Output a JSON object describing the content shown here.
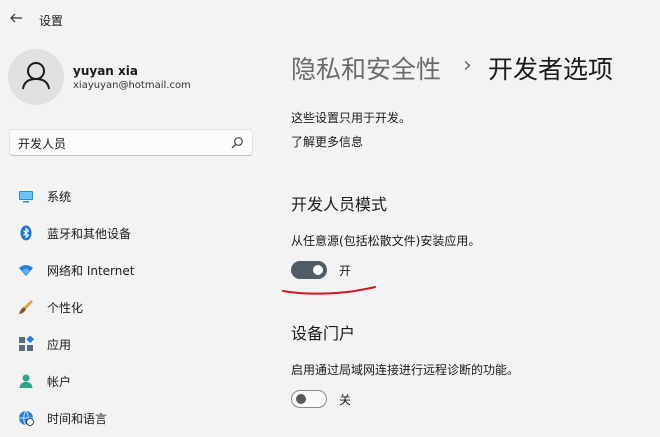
{
  "window": {
    "title": "设置"
  },
  "user": {
    "name": "yuyan xia",
    "email": "xiayuyan@hotmail.com"
  },
  "search": {
    "value": "开发人员"
  },
  "sidebar": {
    "items": [
      {
        "label": "系统",
        "icon": "system-icon"
      },
      {
        "label": "蓝牙和其他设备",
        "icon": "bluetooth-icon"
      },
      {
        "label": "网络和 Internet",
        "icon": "wifi-icon"
      },
      {
        "label": "个性化",
        "icon": "brush-icon"
      },
      {
        "label": "应用",
        "icon": "apps-icon"
      },
      {
        "label": "帐户",
        "icon": "account-icon"
      },
      {
        "label": "时间和语言",
        "icon": "globe-clock-icon"
      }
    ]
  },
  "breadcrumb": {
    "parent": "隐私和安全性",
    "separator": "›",
    "current": "开发者选项"
  },
  "main": {
    "description": "这些设置只用于开发。",
    "learn_more": "了解更多信息",
    "developer_mode": {
      "title": "开发人员模式",
      "description": "从任意源(包括松散文件)安装应用。",
      "state_label": "开",
      "on": true
    },
    "device_portal": {
      "title": "设备门户",
      "description": "启用通过局域网连接进行远程诊断的功能。",
      "state_label": "关",
      "on": false
    }
  },
  "colors": {
    "toggle_on": "#505b66",
    "annotation": "#d3152a",
    "background": "#f3f3f3"
  }
}
